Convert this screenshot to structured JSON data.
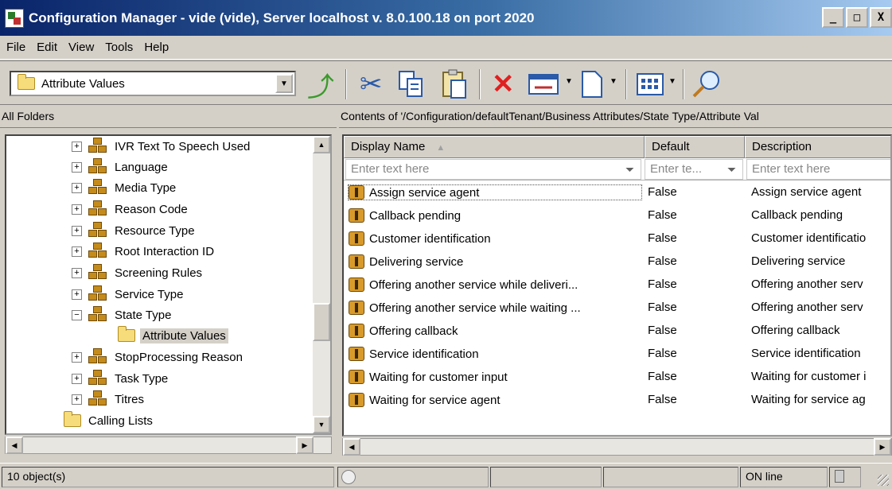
{
  "window": {
    "title": "Configuration Manager - vide  (vide), Server localhost v. 8.0.100.18 on port 2020",
    "minimize": "_",
    "maximize": "□",
    "close": "X"
  },
  "menu": [
    "File",
    "Edit",
    "View",
    "Tools",
    "Help"
  ],
  "toolbar": {
    "folder_combo": "Attribute Values",
    "buttons": [
      "up-folder",
      "cut",
      "copy",
      "paste",
      "delete",
      "properties",
      "new",
      "view-options",
      "find"
    ]
  },
  "tree": {
    "header": "All Folders",
    "items": [
      {
        "label": "IVR Text To Speech Used",
        "expander": "+",
        "icon": "attribute-icon"
      },
      {
        "label": "Language",
        "expander": "+",
        "icon": "attribute-icon"
      },
      {
        "label": "Media Type",
        "expander": "+",
        "icon": "attribute-icon"
      },
      {
        "label": "Reason Code",
        "expander": "+",
        "icon": "attribute-icon"
      },
      {
        "label": "Resource Type",
        "expander": "+",
        "icon": "attribute-icon"
      },
      {
        "label": "Root Interaction ID",
        "expander": "+",
        "icon": "attribute-icon"
      },
      {
        "label": "Screening Rules",
        "expander": "+",
        "icon": "attribute-icon"
      },
      {
        "label": "Service Type",
        "expander": "+",
        "icon": "attribute-icon"
      },
      {
        "label": "State Type",
        "expander": "−",
        "icon": "attribute-icon"
      },
      {
        "label": "Attribute Values",
        "expander": "",
        "icon": "folder-icon",
        "selected": true
      },
      {
        "label": "StopProcessing Reason",
        "expander": "+",
        "icon": "attribute-icon"
      },
      {
        "label": "Task Type",
        "expander": "+",
        "icon": "attribute-icon"
      },
      {
        "label": "Titres",
        "expander": "+",
        "icon": "attribute-icon"
      },
      {
        "label": "Calling Lists",
        "expander": "",
        "icon": "folder-icon"
      }
    ]
  },
  "content": {
    "header": "Contents of '/Configuration/defaultTenant/Business Attributes/State Type/Attribute Val",
    "columns": [
      "Display Name",
      "Default",
      "Description"
    ],
    "filters": [
      "Enter text here",
      "Enter te...",
      "Enter text here"
    ],
    "rows": [
      {
        "name": "Assign service agent",
        "default": "False",
        "description": "Assign service agent"
      },
      {
        "name": "Callback pending",
        "default": "False",
        "description": "Callback pending"
      },
      {
        "name": "Customer identification",
        "default": "False",
        "description": "Customer identificatio"
      },
      {
        "name": "Delivering service",
        "default": "False",
        "description": "Delivering service"
      },
      {
        "name": "Offering another service while deliveri...",
        "default": "False",
        "description": "Offering another serv"
      },
      {
        "name": "Offering another service while waiting ...",
        "default": "False",
        "description": "Offering another serv"
      },
      {
        "name": "Offering callback",
        "default": "False",
        "description": "Offering callback"
      },
      {
        "name": "Service identification",
        "default": "False",
        "description": "Service identification"
      },
      {
        "name": "Waiting for customer input",
        "default": "False",
        "description": "Waiting for customer i"
      },
      {
        "name": "Waiting for service agent",
        "default": "False",
        "description": "Waiting for service ag"
      }
    ]
  },
  "status": {
    "objects": "10 object(s)",
    "connection": "ON line"
  }
}
